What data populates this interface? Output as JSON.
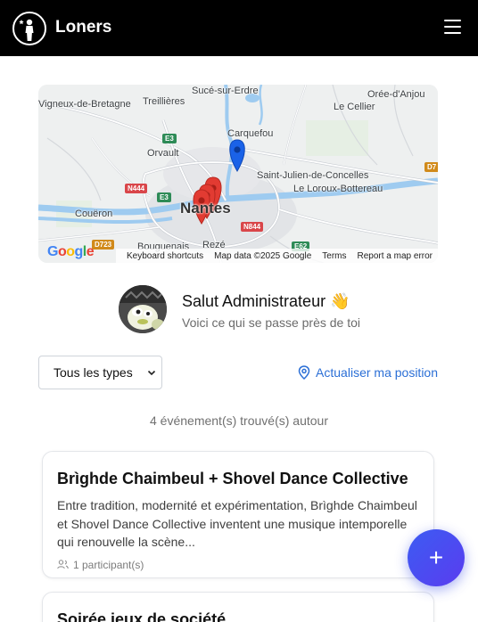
{
  "header": {
    "title": "Loners",
    "menu_icon": "hamburger-icon",
    "logo_icon": "lone-figure-icon"
  },
  "map": {
    "labels": {
      "suce": "Sucé-sur-Erdre",
      "oree": "Orée-d'Anjou",
      "vigneux": "Vigneux-de-Bretagne",
      "treillieres": "Treillières",
      "lecellier": "Le Cellier",
      "carquefou": "Carquefou",
      "orvault": "Orvault",
      "stjulien": "Saint-Julien-de-Concelles",
      "loroux": "Le Loroux-Bottereau",
      "coueron": "Couëron",
      "nantes": "Nantes",
      "bouguenais": "Bouguenais",
      "reze": "Rezé"
    },
    "shields": {
      "e3a": "E3",
      "e3b": "E3",
      "n444": "N444",
      "n844": "N844",
      "e62": "E62",
      "d723": "D723",
      "d7": "D7"
    },
    "google": "Google",
    "footer": {
      "shortcuts": "Keyboard shortcuts",
      "mapdata": "Map data ©2025 Google",
      "terms": "Terms",
      "report": "Report a map error"
    },
    "colors": {
      "pin_red": "#e23b32",
      "pin_blue": "#1a62e8",
      "water": "#a7d1f3",
      "road": "#ffffff"
    }
  },
  "profile": {
    "greeting": "Salut Administrateur 👋",
    "subtitle": "Voici ce qui se passe près de toi"
  },
  "filters": {
    "type_selected": "Tous les types",
    "refresh_label": "Actualiser ma position"
  },
  "results": {
    "count_text": "4 événement(s) trouvé(s) autour"
  },
  "events": [
    {
      "title": "Brìghde Chaimbeul + Shovel Dance Collective",
      "description": "Entre tradition, modernité et expérimentation, Brìghde Chaimbeul et Shovel Dance Collective inventent une musique intemporelle qui renouvelle la scène...",
      "participants": "1 participant(s)"
    },
    {
      "title": "Soirée jeux de société"
    }
  ],
  "fab": {
    "label": "+"
  },
  "accent_color": "#2b6fd6"
}
